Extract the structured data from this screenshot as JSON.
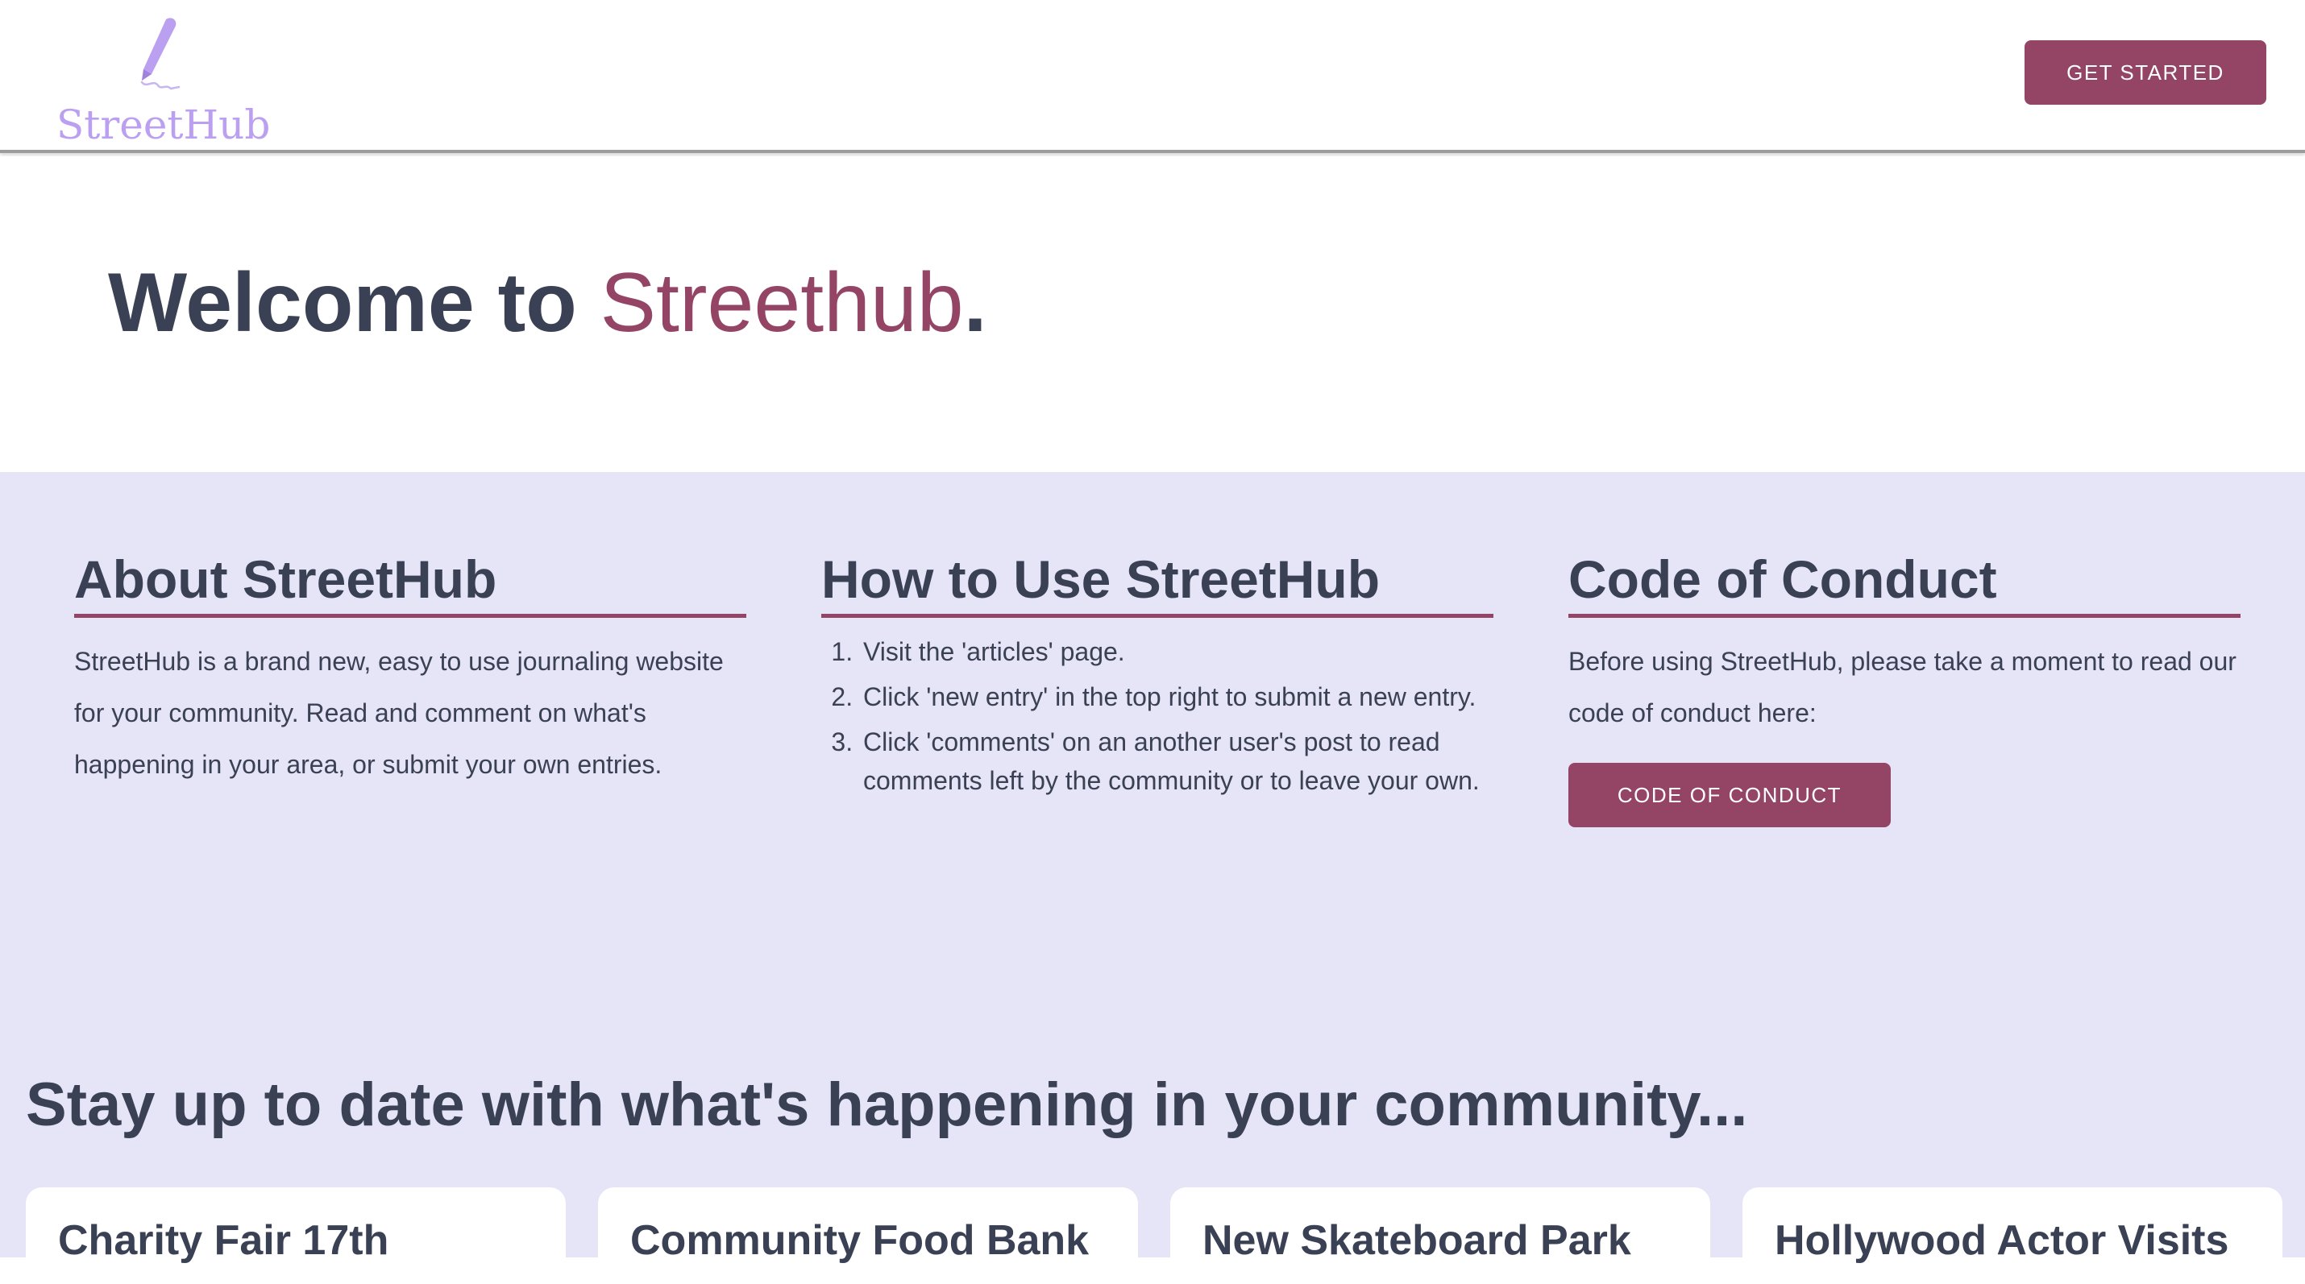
{
  "header": {
    "logo_text": "StreetHub",
    "get_started_label": "GET STARTED"
  },
  "hero": {
    "title_prefix": "Welcome to ",
    "title_accent": "Streethub",
    "title_suffix": "."
  },
  "about": {
    "heading": "About StreetHub",
    "body": "StreetHub is a brand new, easy to use journaling website for your community. Read and comment on what's happening in your area, or submit your own entries."
  },
  "how_to": {
    "heading": "How to Use StreetHub",
    "steps": [
      "Visit the 'articles' page.",
      "Click 'new entry' in the top right to submit a new entry.",
      "Click 'comments' on an another user's post to read comments left by the community or to leave your own."
    ]
  },
  "conduct": {
    "heading": "Code of Conduct",
    "body": "Before using StreetHub, please take a moment to read our code of conduct here:",
    "button_label": "CODE OF CONDUCT"
  },
  "updates": {
    "title": "Stay up to date with what's happening in your community...",
    "cards": [
      {
        "title": "Charity Fair 17th"
      },
      {
        "title": "Community Food Bank"
      },
      {
        "title": "New Skateboard Park"
      },
      {
        "title": "Hollywood Actor Visits"
      }
    ]
  },
  "colors": {
    "accent": "#944565",
    "logo": "#bb9ff0",
    "text": "#3b4154",
    "section_bg": "#e6e4f7"
  },
  "icons": {
    "logo": "quill-pen-icon"
  }
}
